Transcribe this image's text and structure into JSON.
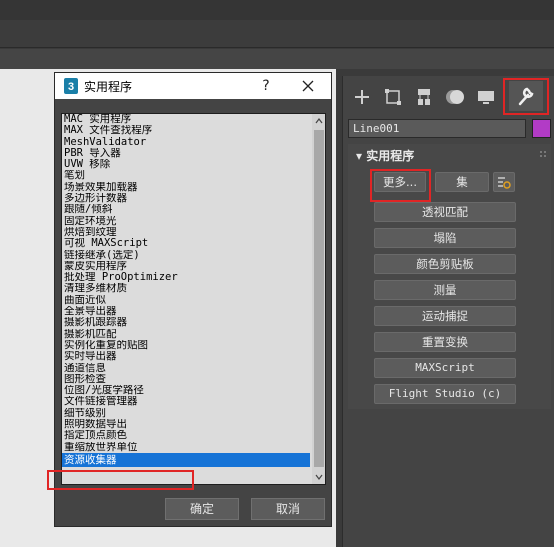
{
  "dialog": {
    "title": "实用程序",
    "help_label": "?",
    "items": [
      "MAC 实用程序",
      "MAX 文件查找程序",
      "MeshValidator",
      "PBR 导入器",
      "UVW 移除",
      "笔划",
      "场景效果加载器",
      "多边形计数器",
      "跟随/倾斜",
      "固定环境光",
      "烘焙到纹理",
      "可视 MAXScript",
      "链接继承(选定)",
      "蒙皮实用程序",
      "批处理 ProOptimizer",
      "清理多维材质",
      "曲面近似",
      "全景导出器",
      "摄影机跟踪器",
      "摄影机匹配",
      "实例化重复的贴图",
      "实时导出器",
      "通道信息",
      "图形检查",
      "位图/光度学路径",
      "文件链接管理器",
      "细节级别",
      "照明数据导出",
      "指定顶点颜色",
      "重缩放世界单位",
      "资源收集器"
    ],
    "selected_item": "资源收集器",
    "ok_label": "确定",
    "cancel_label": "取消"
  },
  "command_panel": {
    "tabs": [
      "create-tab",
      "modify-tab",
      "hierarchy-tab",
      "motion-tab",
      "display-tab",
      "utilities-tab"
    ],
    "active_tab": "utilities-tab",
    "object_name": "Line001",
    "object_color": "#b23bc6",
    "rollout_title": "实用程序",
    "more_label": "更多...",
    "sets_label": "集",
    "buttons": [
      "透视匹配",
      "塌陷",
      "颜色剪贴板",
      "测量",
      "运动捕捉",
      "重置变换",
      "MAXScript",
      "Flight Studio (c)"
    ]
  },
  "colors": {
    "highlight": "#e02525",
    "selection": "#1673d6"
  }
}
